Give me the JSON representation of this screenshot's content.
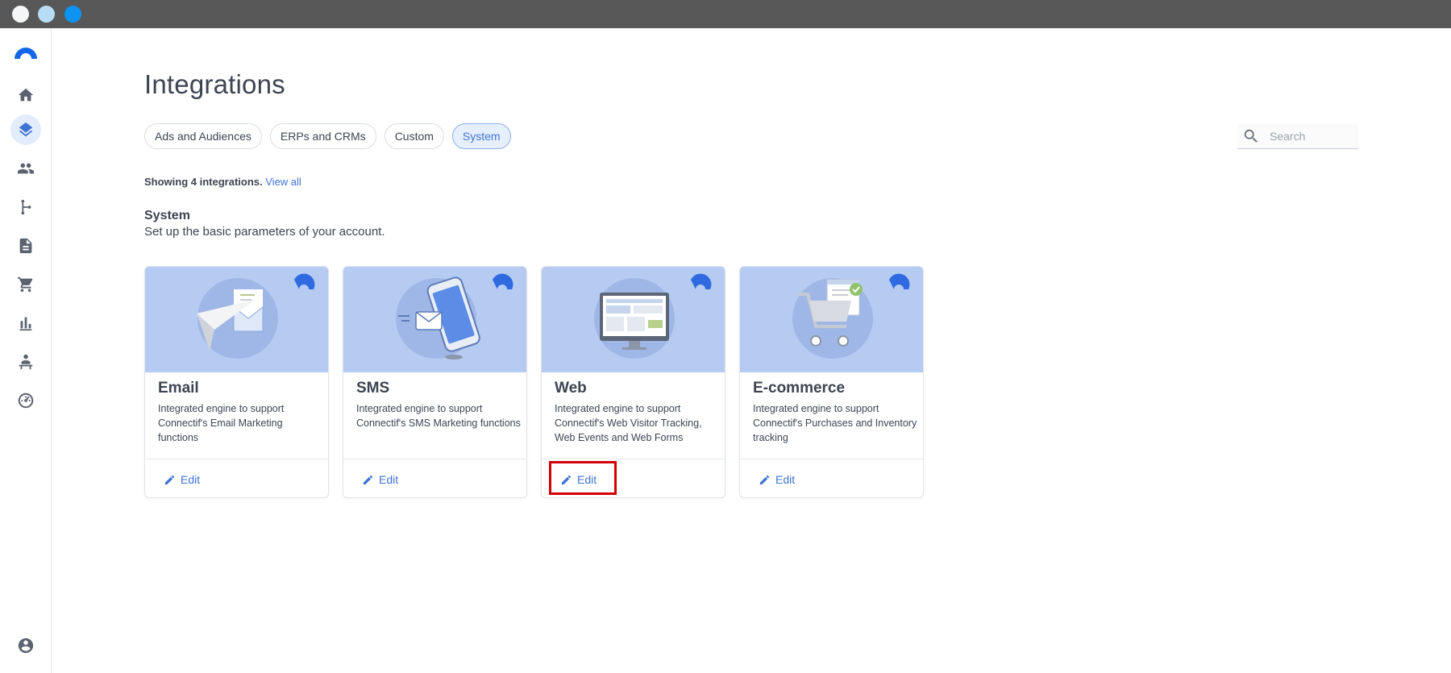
{
  "page": {
    "title": "Integrations"
  },
  "tabs": [
    {
      "label": "Ads and Audiences",
      "active": false
    },
    {
      "label": "ERPs and CRMs",
      "active": false
    },
    {
      "label": "Custom",
      "active": false
    },
    {
      "label": "System",
      "active": true
    }
  ],
  "search": {
    "placeholder": "Search",
    "icon": "search-icon"
  },
  "summary": {
    "showing_text": "Showing 4 integrations.",
    "view_all_label": "View all"
  },
  "section": {
    "title": "System",
    "description": "Set up the basic parameters of your account."
  },
  "sidebar": {
    "items": [
      {
        "icon": "home-icon"
      },
      {
        "icon": "layers-icon",
        "active": true
      },
      {
        "icon": "people-icon"
      },
      {
        "icon": "flow-icon"
      },
      {
        "icon": "document-icon"
      },
      {
        "icon": "cart-icon"
      },
      {
        "icon": "bar-chart-icon"
      },
      {
        "icon": "person-desk-icon"
      },
      {
        "icon": "dashboard-icon"
      },
      {
        "icon": "account-icon"
      }
    ]
  },
  "cards": [
    {
      "title": "Email",
      "description": "Integrated engine to support Connectif's Email Marketing functions",
      "edit_label": "Edit"
    },
    {
      "title": "SMS",
      "description": "Integrated engine to support Connectif's SMS Marketing functions",
      "edit_label": "Edit"
    },
    {
      "title": "Web",
      "description": "Integrated engine to support Connectif's Web Visitor Tracking, Web Events and Web Forms",
      "edit_label": "Edit"
    },
    {
      "title": "E-commerce",
      "description": "Integrated engine to support Connectif's Purchases and Inventory tracking",
      "edit_label": "Edit"
    }
  ],
  "colors": {
    "accent": "#3e73d4",
    "card_header_bg": "#b6cbf1",
    "highlight": "#d40000"
  }
}
